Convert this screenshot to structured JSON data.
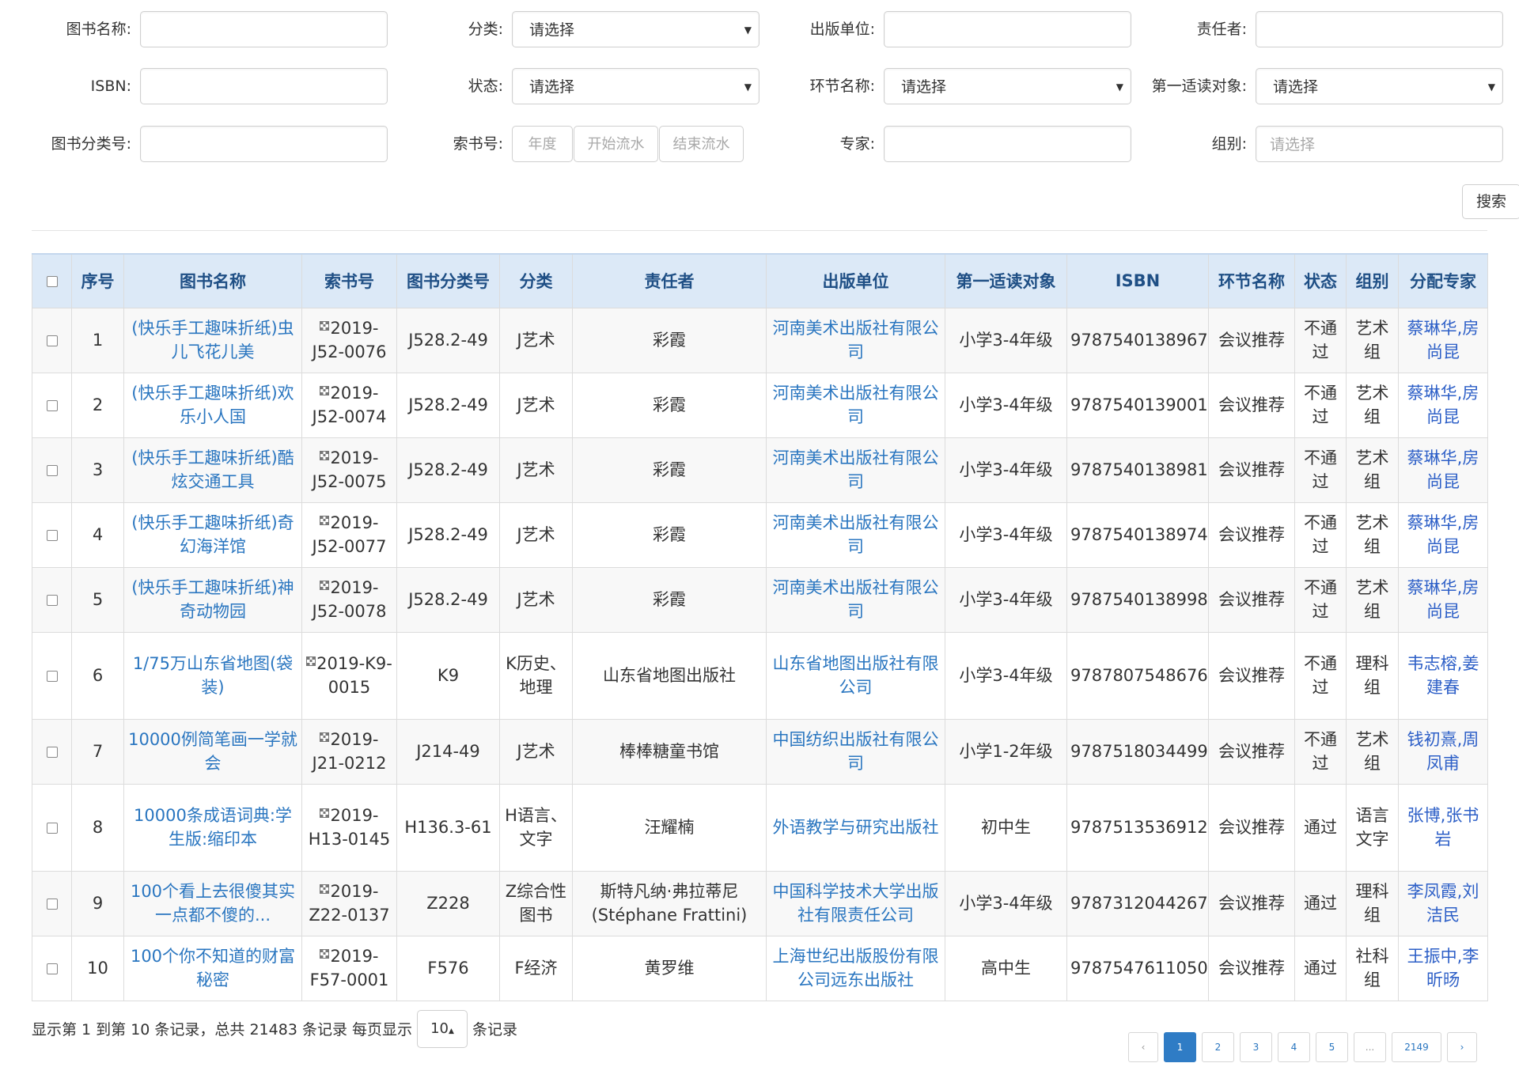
{
  "filters": {
    "book_name": {
      "label": "图书名称:",
      "value": ""
    },
    "category": {
      "label": "分类:",
      "value": "请选择"
    },
    "publisher": {
      "label": "出版单位:",
      "value": ""
    },
    "responsible": {
      "label": "责任者:",
      "value": ""
    },
    "isbn": {
      "label": "ISBN:",
      "value": ""
    },
    "status": {
      "label": "状态:",
      "value": "请选择"
    },
    "stage": {
      "label": "环节名称:",
      "value": "请选择"
    },
    "audience": {
      "label": "第一适读对象:",
      "value": "请选择"
    },
    "class_no": {
      "label": "图书分类号:",
      "value": ""
    },
    "call_no": {
      "label": "索书号:",
      "year_placeholder": "年度",
      "start_placeholder": "开始流水",
      "end_placeholder": "结束流水"
    },
    "expert": {
      "label": "专家:",
      "value": ""
    },
    "group": {
      "label": "组别:",
      "placeholder": "请选择"
    },
    "search_label": "搜索"
  },
  "table": {
    "headers": [
      "",
      "序号",
      "图书名称",
      "索书号",
      "图书分类号",
      "分类",
      "责任者",
      "出版单位",
      "第一适读对象",
      "ISBN",
      "环节名称",
      "状态",
      "组别",
      "分配专家"
    ],
    "rows": [
      {
        "no": "1",
        "title": "(快乐手工趣味折纸)虫儿飞花儿美",
        "call": "2019-J52-0076",
        "cls": "J528.2-49",
        "cat": "J艺术",
        "author": "彩霞",
        "pub": "河南美术出版社有限公司",
        "aud": "小学3-4年级",
        "isbn": "9787540138967",
        "stage": "会议推荐",
        "status": "不通过",
        "group": "艺术组",
        "experts": "蔡琳华,房尚昆"
      },
      {
        "no": "2",
        "title": "(快乐手工趣味折纸)欢乐小人国",
        "call": "2019-J52-0074",
        "cls": "J528.2-49",
        "cat": "J艺术",
        "author": "彩霞",
        "pub": "河南美术出版社有限公司",
        "aud": "小学3-4年级",
        "isbn": "9787540139001",
        "stage": "会议推荐",
        "status": "不通过",
        "group": "艺术组",
        "experts": "蔡琳华,房尚昆"
      },
      {
        "no": "3",
        "title": "(快乐手工趣味折纸)酷炫交通工具",
        "call": "2019-J52-0075",
        "cls": "J528.2-49",
        "cat": "J艺术",
        "author": "彩霞",
        "pub": "河南美术出版社有限公司",
        "aud": "小学3-4年级",
        "isbn": "9787540138981",
        "stage": "会议推荐",
        "status": "不通过",
        "group": "艺术组",
        "experts": "蔡琳华,房尚昆"
      },
      {
        "no": "4",
        "title": "(快乐手工趣味折纸)奇幻海洋馆",
        "call": "2019-J52-0077",
        "cls": "J528.2-49",
        "cat": "J艺术",
        "author": "彩霞",
        "pub": "河南美术出版社有限公司",
        "aud": "小学3-4年级",
        "isbn": "9787540138974",
        "stage": "会议推荐",
        "status": "不通过",
        "group": "艺术组",
        "experts": "蔡琳华,房尚昆"
      },
      {
        "no": "5",
        "title": "(快乐手工趣味折纸)神奇动物园",
        "call": "2019-J52-0078",
        "cls": "J528.2-49",
        "cat": "J艺术",
        "author": "彩霞",
        "pub": "河南美术出版社有限公司",
        "aud": "小学3-4年级",
        "isbn": "9787540138998",
        "stage": "会议推荐",
        "status": "不通过",
        "group": "艺术组",
        "experts": "蔡琳华,房尚昆"
      },
      {
        "no": "6",
        "title": "1/75万山东省地图(袋装)",
        "call": "2019-K9-0015",
        "cls": "K9",
        "cat": "K历史、地理",
        "author": "山东省地图出版社",
        "pub": "山东省地图出版社有限公司",
        "aud": "小学3-4年级",
        "isbn": "9787807548676",
        "stage": "会议推荐",
        "status": "不通过",
        "group": "理科组",
        "experts": "韦志榕,姜建春"
      },
      {
        "no": "7",
        "title": "10000例简笔画一学就会",
        "call": "2019-J21-0212",
        "cls": "J214-49",
        "cat": "J艺术",
        "author": "棒棒糖童书馆",
        "pub": "中国纺织出版社有限公司",
        "aud": "小学1-2年级",
        "isbn": "9787518034499",
        "stage": "会议推荐",
        "status": "不通过",
        "group": "艺术组",
        "experts": "钱初熹,周凤甫"
      },
      {
        "no": "8",
        "title": "10000条成语词典:学生版:缩印本",
        "call": "2019-H13-0145",
        "cls": "H136.3-61",
        "cat": "H语言、文字",
        "author": "汪耀楠",
        "pub": "外语教学与研究出版社",
        "aud": "初中生",
        "isbn": "9787513536912",
        "stage": "会议推荐",
        "status": "通过",
        "group": "语言文字",
        "experts": "张博,张书岩"
      },
      {
        "no": "9",
        "title": "100个看上去很傻其实一点都不傻的...",
        "call": "2019-Z22-0137",
        "cls": "Z228",
        "cat": "Z综合性图书",
        "author": "斯特凡纳·弗拉蒂尼(Stéphane Frattini)",
        "pub": "中国科学技术大学出版社有限责任公司",
        "aud": "小学3-4年级",
        "isbn": "9787312044267",
        "stage": "会议推荐",
        "status": "通过",
        "group": "理科组",
        "experts": "李凤霞,刘洁民"
      },
      {
        "no": "10",
        "title": "100个你不知道的财富秘密",
        "call": "2019-F57-0001",
        "cls": "F576",
        "cat": "F经济",
        "author": "黄罗维",
        "pub": "上海世纪出版股份有限公司远东出版社",
        "aud": "高中生",
        "isbn": "9787547611050",
        "stage": "会议推荐",
        "status": "通过",
        "group": "社科组",
        "experts": "王振中,李昕旸"
      }
    ]
  },
  "footer": {
    "info_prefix": "显示第 1 到第 10 条记录，总共 21483 条记录 每页显示",
    "page_size": "10",
    "info_suffix": "条记录"
  },
  "pagination": [
    "‹",
    "1",
    "2",
    "3",
    "4",
    "5",
    "...",
    "2149",
    "›"
  ],
  "current_page": "1",
  "colors": {
    "header_bg": "#dce9f7",
    "header_text": "#1f4f85",
    "link": "#2a76c0",
    "expert": "#2d5fc7",
    "active_page": "#2f7cc5"
  }
}
